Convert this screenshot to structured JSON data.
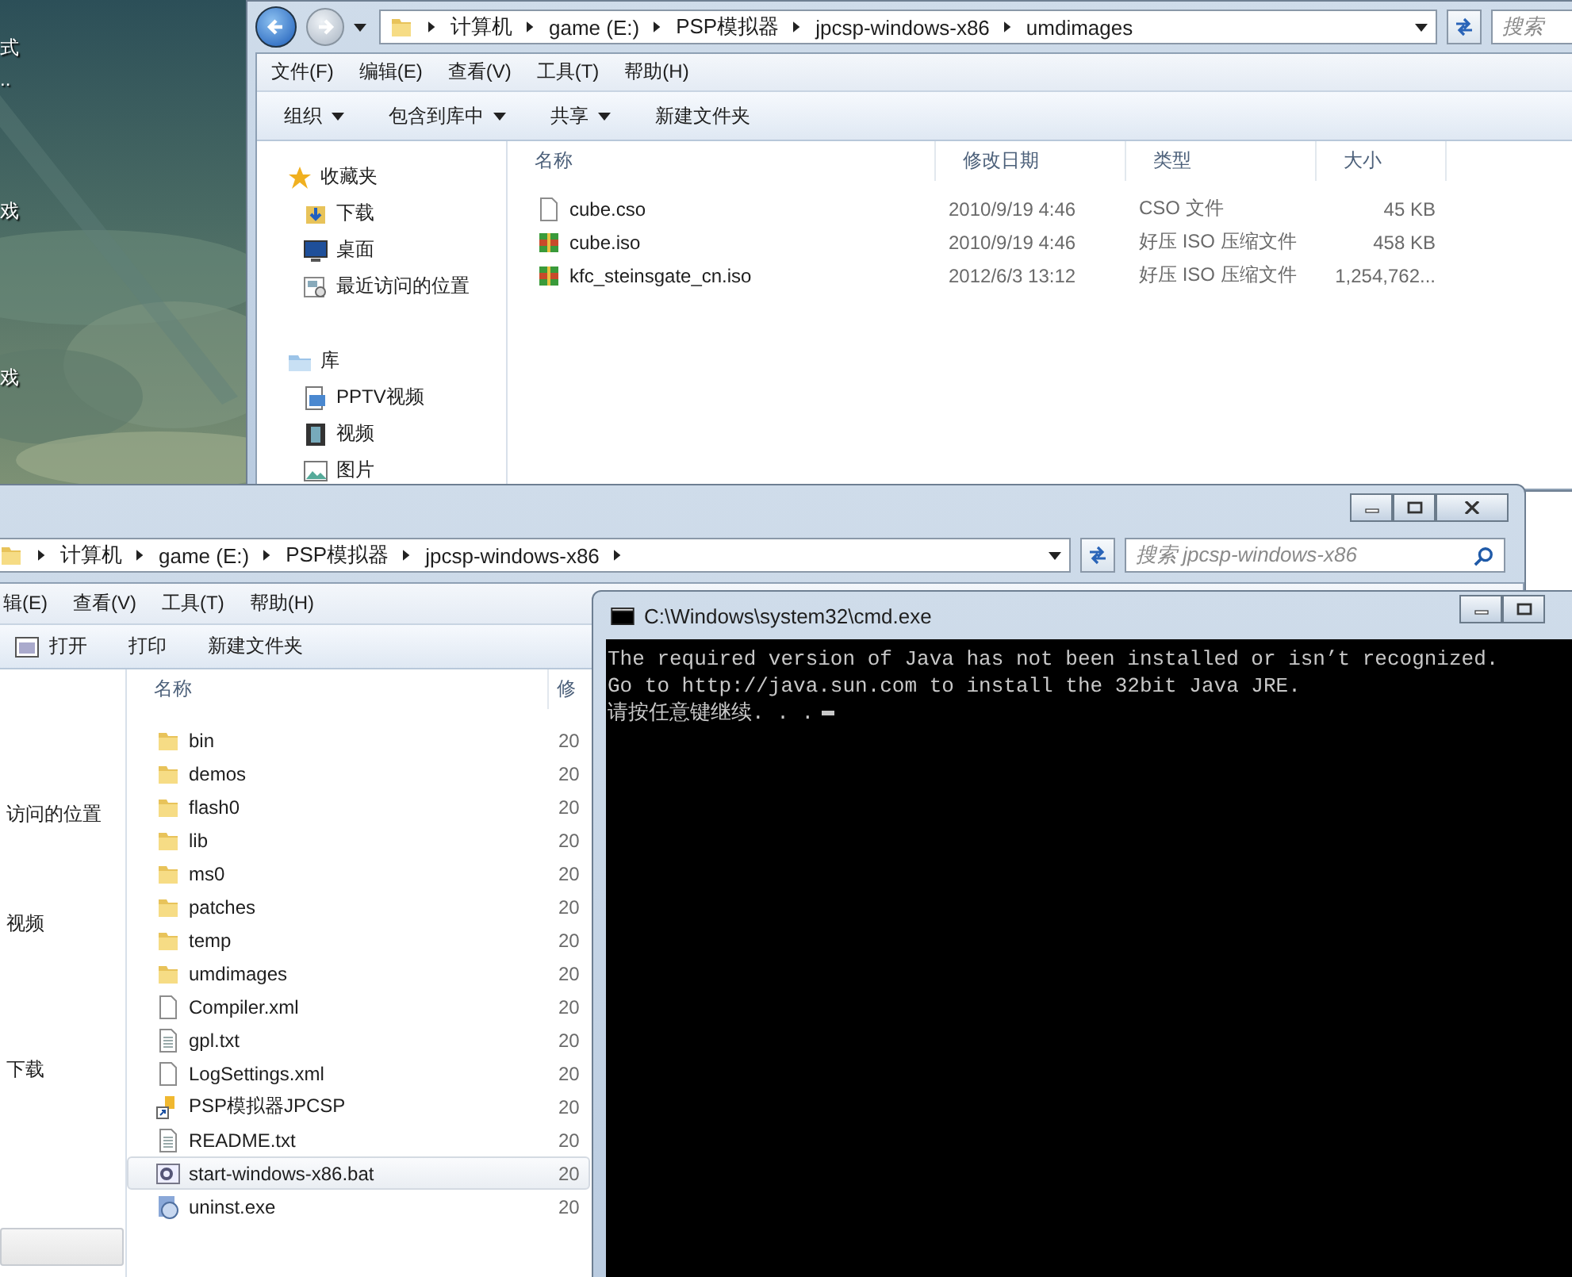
{
  "desktop": {
    "labels": [
      "式",
      "..",
      "戏",
      "戏"
    ]
  },
  "explorer_back": {
    "address": [
      "计算机",
      "game (E:)",
      "PSP模拟器",
      "jpcsp-windows-x86",
      "umdimages"
    ],
    "search": {
      "placeholder": "搜索"
    },
    "menu": [
      "文件(F)",
      "编辑(E)",
      "查看(V)",
      "工具(T)",
      "帮助(H)"
    ],
    "toolbar": [
      {
        "label": "组织",
        "dropdown": true
      },
      {
        "label": "包含到库中",
        "dropdown": true
      },
      {
        "label": "共享",
        "dropdown": true
      },
      {
        "label": "新建文件夹",
        "dropdown": false
      }
    ],
    "nav": [
      {
        "label": "收藏夹",
        "kind": "group"
      },
      {
        "label": "下载",
        "kind": "item"
      },
      {
        "label": "桌面",
        "kind": "item"
      },
      {
        "label": "最近访问的位置",
        "kind": "item"
      },
      {
        "label": "库",
        "kind": "group"
      },
      {
        "label": "PPTV视频",
        "kind": "item"
      },
      {
        "label": "视频",
        "kind": "item"
      },
      {
        "label": "图片",
        "kind": "item"
      }
    ],
    "columns": [
      "名称",
      "修改日期",
      "类型",
      "大小"
    ],
    "rows": [
      {
        "kind": "file",
        "name": "cube.cso",
        "modified": "2010/9/19 4:46",
        "type": "CSO 文件",
        "size": "45 KB"
      },
      {
        "kind": "archive",
        "name": "cube.iso",
        "modified": "2010/9/19 4:46",
        "type": "好压 ISO 压缩文件",
        "size": "458 KB"
      },
      {
        "kind": "archive",
        "name": "kfc_steinsgate_cn.iso",
        "modified": "2012/6/3 13:12",
        "type": "好压 ISO 压缩文件",
        "size": "1,254,762..."
      }
    ]
  },
  "explorer_front": {
    "address": [
      "计算机",
      "game (E:)",
      "PSP模拟器",
      "jpcsp-windows-x86"
    ],
    "search": {
      "placeholder": "搜索 jpcsp-windows-x86"
    },
    "menu": [
      "辑(E)",
      "查看(V)",
      "工具(T)",
      "帮助(H)"
    ],
    "toolbar": [
      "打开",
      "打印",
      "新建文件夹"
    ],
    "nav": [
      "访问的位置",
      "视频",
      "下载"
    ],
    "columns": [
      "名称",
      "修"
    ],
    "rows": [
      {
        "kind": "folder",
        "name": "bin",
        "modified": "20",
        "selected": false
      },
      {
        "kind": "folder",
        "name": "demos",
        "modified": "20",
        "selected": false
      },
      {
        "kind": "folder",
        "name": "flash0",
        "modified": "20",
        "selected": false
      },
      {
        "kind": "folder",
        "name": "lib",
        "modified": "20",
        "selected": false
      },
      {
        "kind": "folder",
        "name": "ms0",
        "modified": "20",
        "selected": false
      },
      {
        "kind": "folder",
        "name": "patches",
        "modified": "20",
        "selected": false
      },
      {
        "kind": "folder",
        "name": "temp",
        "modified": "20",
        "selected": false
      },
      {
        "kind": "folder",
        "name": "umdimages",
        "modified": "20",
        "selected": false
      },
      {
        "kind": "file",
        "name": "Compiler.xml",
        "modified": "20",
        "selected": false
      },
      {
        "kind": "text",
        "name": "gpl.txt",
        "modified": "20",
        "selected": false
      },
      {
        "kind": "file",
        "name": "LogSettings.xml",
        "modified": "20",
        "selected": false
      },
      {
        "kind": "shortcut",
        "name": "PSP模拟器JPCSP",
        "modified": "20",
        "selected": false
      },
      {
        "kind": "text",
        "name": "README.txt",
        "modified": "20",
        "selected": false
      },
      {
        "kind": "batch",
        "name": "start-windows-x86.bat",
        "modified": "20",
        "selected": true
      },
      {
        "kind": "installer",
        "name": "uninst.exe",
        "modified": "20",
        "selected": false
      }
    ]
  },
  "console": {
    "title": "C:\\Windows\\system32\\cmd.exe",
    "lines": [
      "The required version of Java has not been installed or isn’t recognized.",
      "Go to http://java.sun.com to install the 32bit Java JRE.",
      "请按任意键继续. . ."
    ]
  }
}
